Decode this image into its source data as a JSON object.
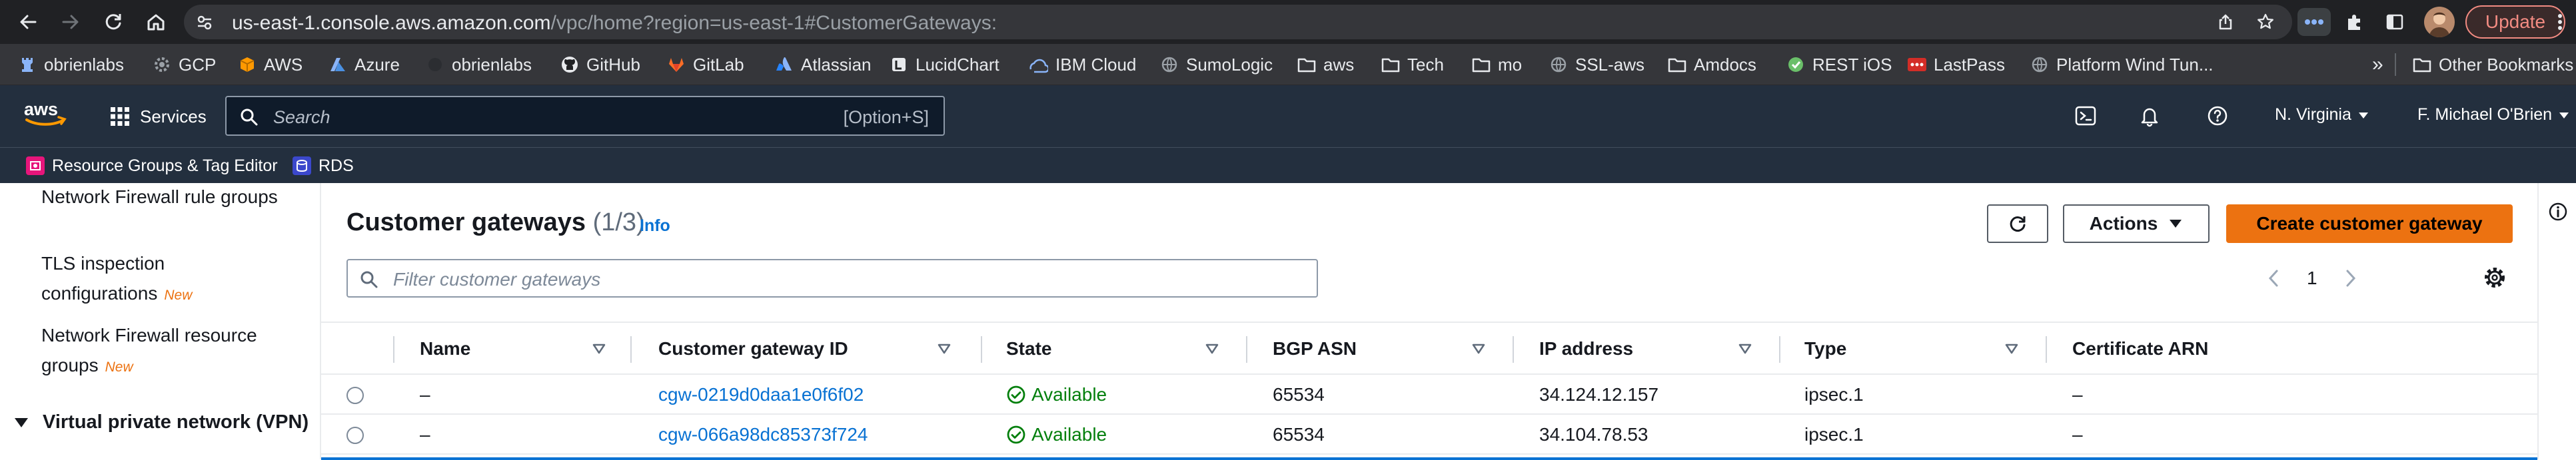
{
  "browser": {
    "url_host": "us-east-1.console.aws.amazon.com",
    "url_path": "/vpc/home?region=us-east-1#CustomerGateways:",
    "update_label": "Update"
  },
  "bookmarks": [
    {
      "label": "obrienlabs",
      "icon": "rook-icon"
    },
    {
      "label": "GCP",
      "icon": "gear-icon"
    },
    {
      "label": "AWS",
      "icon": "box-icon"
    },
    {
      "label": "Azure",
      "icon": "azure-icon"
    },
    {
      "label": "obrienlabs",
      "icon": "dark-icon"
    },
    {
      "label": "GitHub",
      "icon": "github-icon"
    },
    {
      "label": "GitLab",
      "icon": "gitlab-icon"
    },
    {
      "label": "Atlassian",
      "icon": "atlassian-icon"
    },
    {
      "label": "LucidChart",
      "icon": "lucid-icon"
    },
    {
      "label": "IBM Cloud",
      "icon": "ibm-icon"
    },
    {
      "label": "SumoLogic",
      "icon": "globe-icon"
    },
    {
      "label": "aws",
      "icon": "folder-icon"
    },
    {
      "label": "Tech",
      "icon": "folder-icon"
    },
    {
      "label": "mo",
      "icon": "folder-icon"
    },
    {
      "label": "SSL-aws",
      "icon": "globe-icon"
    },
    {
      "label": "Amdocs",
      "icon": "folder-icon"
    },
    {
      "label": "REST iOS",
      "icon": "rest-icon"
    },
    {
      "label": "LastPass",
      "icon": "lastpass-icon"
    },
    {
      "label": "Platform Wind Tun...",
      "icon": "globe-icon"
    }
  ],
  "bookmarks_overflow": "»",
  "other_bookmarks": "Other Bookmarks",
  "aws": {
    "services_label": "Services",
    "search_placeholder": "Search",
    "search_shortcut": "[Option+S]",
    "region": "N. Virginia",
    "user": "F. Michael O'Brien",
    "favorites": [
      {
        "label": "Resource Groups & Tag Editor"
      },
      {
        "label": "RDS"
      }
    ]
  },
  "sidebar": {
    "items": [
      {
        "label": "Network Firewall rule groups",
        "badge": ""
      },
      {
        "label": "TLS inspection configurations",
        "badge": "New"
      },
      {
        "label": "Network Firewall resource groups",
        "badge": "New"
      }
    ],
    "section": "Virtual private network (VPN)"
  },
  "panel": {
    "title": "Customer gateways",
    "count": "(1/3)",
    "info": "Info",
    "actions_label": "Actions",
    "create_label": "Create customer gateway",
    "filter_placeholder": "Filter customer gateways",
    "page": "1"
  },
  "table": {
    "columns": [
      "Name",
      "Customer gateway ID",
      "State",
      "BGP ASN",
      "IP address",
      "Type",
      "Certificate ARN"
    ],
    "rows": [
      {
        "name": "–",
        "id": "cgw-0219d0daa1e0f6f02",
        "state": "Available",
        "bgp": "65534",
        "ip": "34.124.12.157",
        "type": "ipsec.1",
        "cert": "–"
      },
      {
        "name": "–",
        "id": "cgw-066a98dc85373f724",
        "state": "Available",
        "bgp": "65534",
        "ip": "34.104.78.53",
        "type": "ipsec.1",
        "cert": "–"
      }
    ]
  },
  "colors": {
    "aws_nav": "#232f3e",
    "accent_orange": "#ec7211",
    "link_blue": "#0972d3",
    "success_green": "#037f0c"
  }
}
